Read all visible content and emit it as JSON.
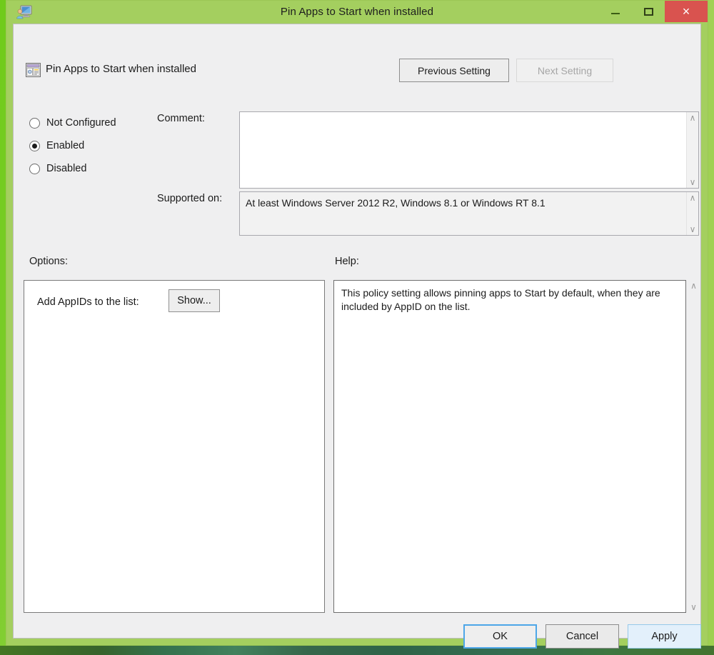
{
  "desktop": {
    "background_color": "#8ccf3f"
  },
  "window": {
    "title": "Pin Apps to Start when installed",
    "icon": "gpedit-computer-user-icon",
    "frame_color": "#a4cf5f",
    "controls": {
      "minimize_label": "–",
      "maximize_label": "❐",
      "close_label": "×",
      "close_color": "#d9534f"
    }
  },
  "header": {
    "policy_icon": "policy-setting-icon",
    "policy_title": "Pin Apps to Start when installed",
    "previous_setting_label": "Previous Setting",
    "next_setting_label": "Next Setting",
    "next_setting_disabled": true
  },
  "state": {
    "options": [
      {
        "label": "Not Configured",
        "selected": false
      },
      {
        "label": "Enabled",
        "selected": true
      },
      {
        "label": "Disabled",
        "selected": false
      }
    ]
  },
  "comment": {
    "label": "Comment:",
    "value": "",
    "placeholder": ""
  },
  "supported": {
    "label": "Supported on:",
    "value": "At least Windows Server 2012 R2, Windows 8.1 or Windows RT 8.1"
  },
  "sections": {
    "options_label": "Options:",
    "help_label": "Help:"
  },
  "options_panel": {
    "appid_label": "Add AppIDs to the list:",
    "show_button_label": "Show..."
  },
  "help_panel": {
    "text": "This policy setting allows pinning apps to Start by default, when they are included by AppID on the list."
  },
  "scrollbars": {
    "up_arrow": "∧",
    "down_arrow": "∨"
  },
  "footer": {
    "ok_label": "OK",
    "cancel_label": "Cancel",
    "apply_label": "Apply"
  }
}
